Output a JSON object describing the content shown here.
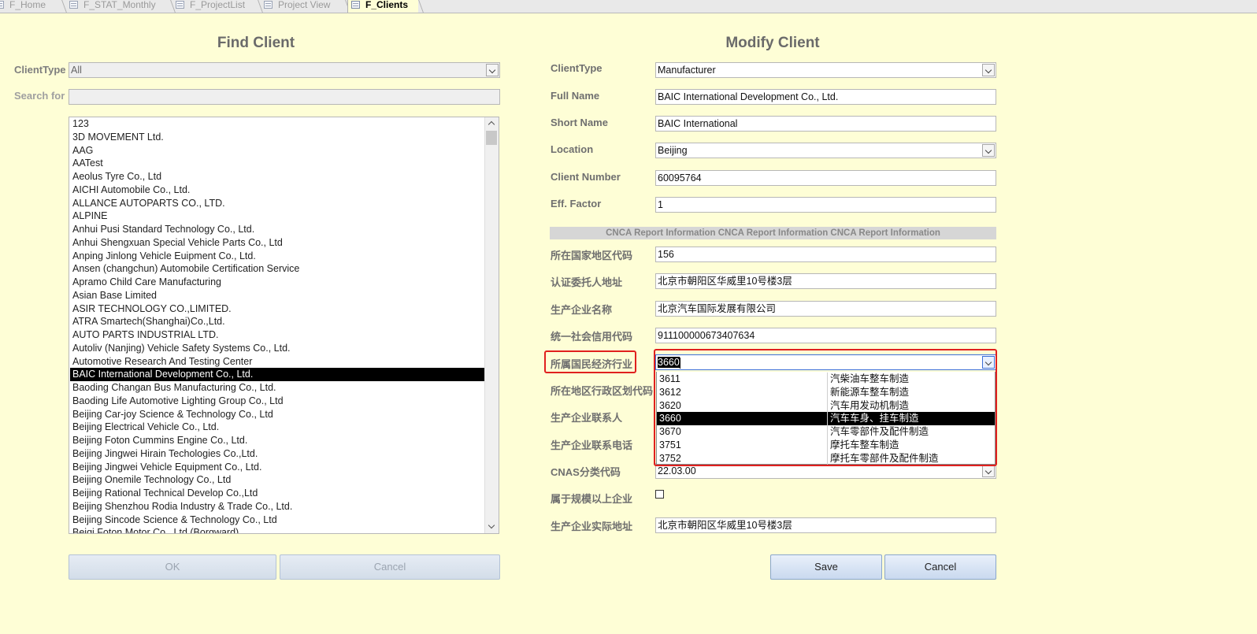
{
  "tabs": [
    {
      "label": "F_Home"
    },
    {
      "label": "F_STAT_Monthly"
    },
    {
      "label": "F_ProjectList"
    },
    {
      "label": "Project View"
    },
    {
      "label": "F_Clients"
    }
  ],
  "find": {
    "title": "Find Client",
    "clienttype_label": "ClientType",
    "clienttype_value": "All",
    "search_label": "Search for",
    "search_value": "",
    "clients": [
      "123",
      "3D MOVEMENT Ltd.",
      "AAG",
      "AATest",
      "Aeolus Tyre Co., Ltd",
      "AICHI Automobile Co., Ltd.",
      "ALLANCE AUTOPARTS CO., LTD.",
      "ALPINE",
      "Anhui Pusi Standard Technology Co., Ltd.",
      "Anhui Shengxuan Special Vehicle Parts Co., Ltd",
      "Anping Jinlong Vehicle Euipment Co., Ltd.",
      "Ansen (changchun) Automobile Certification Service",
      "Apramo Child Care Manufacturing",
      "Asian Base Limited",
      "ASIR TECHNOLOGY CO.,LIMITED.",
      "ATRA Smartech(Shanghai)Co.,Ltd.",
      "AUTO PARTS INDUSTRIAL LTD.",
      "Autoliv (Nanjing) Vehicle Safety Systems Co., Ltd.",
      "Automotive Research And Testing Center",
      "BAIC International Development Co., Ltd.",
      "Baoding Changan Bus Manufacturing Co., Ltd.",
      "Baoding Life Automotive Lighting Group Co., Ltd",
      "Beijing Car-joy Science & Technology Co., Ltd",
      "Beijing Electrical Vehicle Co., Ltd.",
      "Beijing Foton Cummins Engine Co., Ltd.",
      "Beijing Jingwei Hirain Techologies Co.,Ltd.",
      "Beijing Jingwei Vehicle Equipment Co., Ltd.",
      "Beijing Onemile Technology Co., Ltd",
      "Beijing Rational Technical Develop Co.,Ltd",
      "Beijing Shenzhou Rodia Industry & Trade Co., Ltd.",
      "Beijing Sincode Science & Technology Co., Ltd",
      "Beiqi Foton Motor Co., Ltd (Borgward)"
    ],
    "selected_client": "BAIC International Development Co., Ltd.",
    "ok_label": "OK",
    "cancel_label": "Cancel"
  },
  "modify": {
    "title": "Modify Client",
    "fields": {
      "clienttype": {
        "label": "ClientType",
        "value": "Manufacturer"
      },
      "fullname": {
        "label": "Full Name",
        "value": "BAIC International Development Co., Ltd."
      },
      "shortname": {
        "label": "Short Name",
        "value": "BAIC International"
      },
      "location": {
        "label": "Location",
        "value": "Beijing"
      },
      "clientnumber": {
        "label": "Client Number",
        "value": "60095764"
      },
      "efffactor": {
        "label": "Eff. Factor",
        "value": "1"
      }
    },
    "section_title": "CNCA Report Information CNCA Report Information CNCA Report Information",
    "cnca": {
      "country_code": {
        "label": "所在国家地区代码",
        "value": "156"
      },
      "applicant_address": {
        "label": "认证委托人地址",
        "value": "北京市朝阳区华威里10号楼3层"
      },
      "manufacturer_name": {
        "label": "生产企业名称",
        "value": "北京汽车国际发展有限公司"
      },
      "credit_code": {
        "label": "统一社会信用代码",
        "value": "911100000673407634"
      },
      "industry": {
        "label": "所属国民经济行业",
        "value": "3660"
      },
      "region_code": {
        "label": "所在地区行政区划代码"
      },
      "contact": {
        "label": "生产企业联系人"
      },
      "phone": {
        "label": "生产企业联系电话"
      },
      "cnas": {
        "label": "CNAS分类代码",
        "value": "22.03.00"
      },
      "above_scale": {
        "label": "属于规模以上企业",
        "checked": false
      },
      "actual_address": {
        "label": "生产企业实际地址",
        "value": "北京市朝阳区华威里10号楼3层"
      }
    },
    "industry_options": [
      {
        "code": "3611",
        "desc": "汽柴油车整车制造"
      },
      {
        "code": "3612",
        "desc": "新能源车整车制造"
      },
      {
        "code": "3620",
        "desc": "汽车用发动机制造"
      },
      {
        "code": "3660",
        "desc": "汽车车身、挂车制造"
      },
      {
        "code": "3670",
        "desc": "汽车零部件及配件制造"
      },
      {
        "code": "3751",
        "desc": "摩托车整车制造"
      },
      {
        "code": "3752",
        "desc": "摩托车零部件及配件制造"
      }
    ],
    "selected_industry": "3660",
    "save_label": "Save",
    "cancel_label": "Cancel"
  },
  "colors": {
    "background": "#fefed6",
    "highlight": "#e0201e",
    "selection": "#000000"
  }
}
